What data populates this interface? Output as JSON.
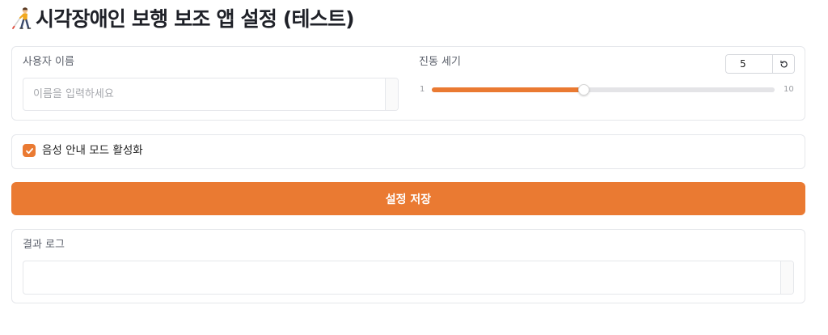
{
  "header": {
    "icon": "person-with-white-cane-icon",
    "title": "시각장애인 보행 보조 앱 설정 (테스트)"
  },
  "settings_panel": {
    "username": {
      "label": "사용자 이름",
      "value": "",
      "placeholder": "이름을 입력하세요"
    },
    "vibration": {
      "label": "진동 세기",
      "value": 5,
      "min": 1,
      "max": 10,
      "reset_icon": "reset-icon"
    }
  },
  "voice_panel": {
    "voice_guide": {
      "label": "음성 안내 모드 활성화",
      "checked": true,
      "check_icon": "check-icon"
    }
  },
  "save_button": {
    "label": "설정 저장"
  },
  "log_panel": {
    "label": "결과 로그",
    "value": ""
  },
  "colors": {
    "accent": "#ea7a32",
    "border": "#e5e7eb",
    "track": "#e4e4e7",
    "label_text": "#5a5f6a",
    "title_text": "#1f2128"
  }
}
